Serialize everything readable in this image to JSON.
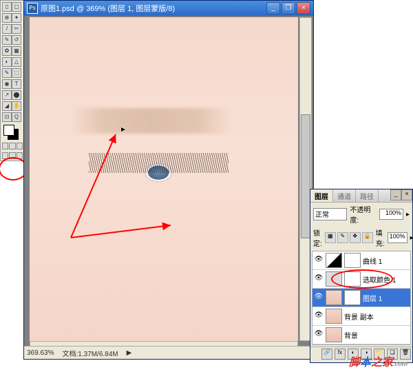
{
  "toolbox": {
    "tools": [
      "▯",
      "▢",
      "⊕",
      "✦",
      "/",
      "✂",
      "✎",
      "↺",
      "✿",
      "▦",
      "◐",
      "△",
      "✎",
      "⬚",
      "◉",
      "T",
      "↗",
      "⬤",
      "◢",
      "✋",
      "⊡",
      "Q"
    ]
  },
  "document": {
    "title": "原图1.psd @ 369% (图层 1, 图层蒙版/8)",
    "zoom": "369.63%",
    "filesize": "文档:1.37M/6.84M"
  },
  "layers_panel": {
    "tabs": [
      "图层",
      "通道",
      "路径"
    ],
    "blend_mode": "正常",
    "opacity_label": "不透明度:",
    "opacity": "100%",
    "lock_label": "锁定:",
    "fill_label": "填充:",
    "fill": "100%",
    "layers": [
      {
        "name": "曲线 1",
        "selected": false,
        "type": "curves"
      },
      {
        "name": "选取颜色 1",
        "selected": false,
        "type": "adjust"
      },
      {
        "name": "图层 1",
        "selected": true,
        "type": "mask"
      },
      {
        "name": "背景 副本",
        "selected": false,
        "type": "photo"
      },
      {
        "name": "背景",
        "selected": false,
        "type": "photo"
      }
    ]
  },
  "watermark": {
    "text1": "脚",
    "text2": "本",
    "text3": "之家",
    "suffix": ".com"
  }
}
